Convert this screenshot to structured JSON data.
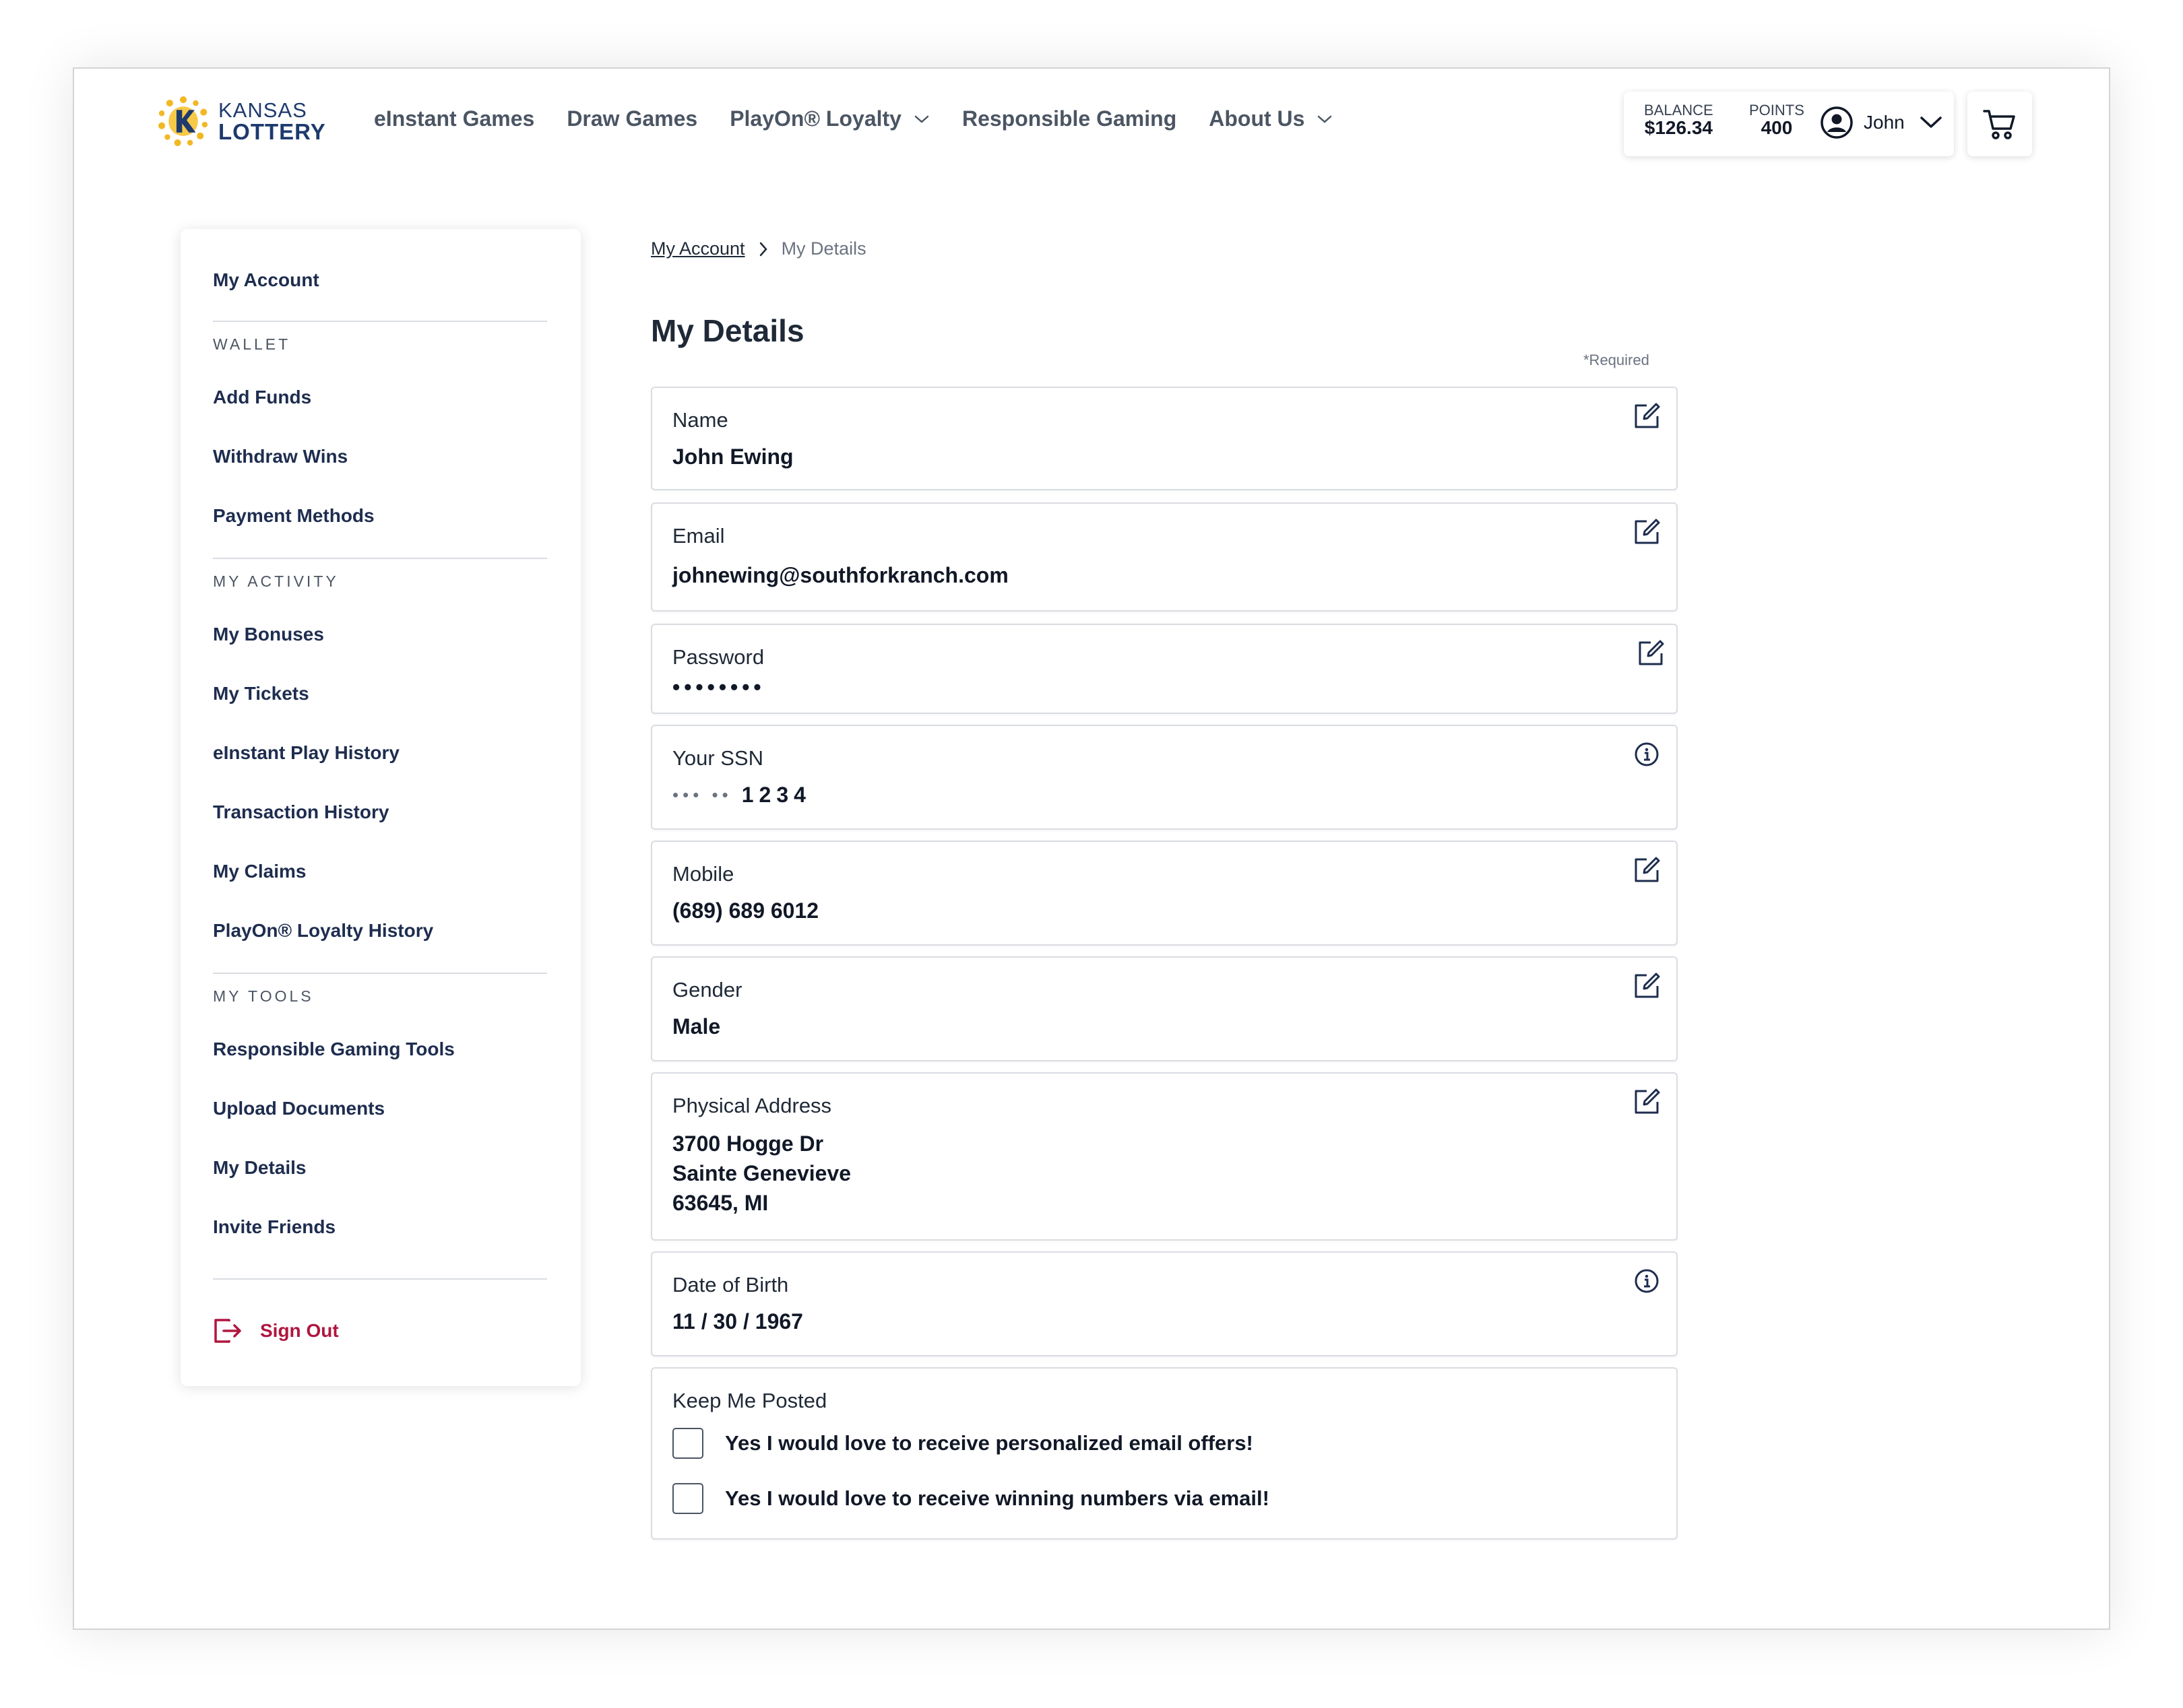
{
  "header": {
    "logo": {
      "line1": "KANSAS",
      "line2": "LOTTERY"
    },
    "nav": [
      {
        "label": "eInstant Games",
        "dropdown": false
      },
      {
        "label": "Draw Games",
        "dropdown": false
      },
      {
        "label": "PlayOn® Loyalty",
        "dropdown": true
      },
      {
        "label": "Responsible Gaming",
        "dropdown": false
      },
      {
        "label": "About Us",
        "dropdown": true
      }
    ],
    "balance": {
      "label": "BALANCE",
      "value": "$126.34"
    },
    "points": {
      "label": "POINTS",
      "value": "400"
    },
    "user": {
      "name": "John"
    }
  },
  "sidebar": {
    "heading": "My Account",
    "wallet": {
      "label": "WALLET",
      "items": [
        "Add Funds",
        "Withdraw Wins",
        "Payment Methods"
      ]
    },
    "activity": {
      "label": "MY ACTIVITY",
      "items": [
        "My Bonuses",
        "My Tickets",
        "eInstant Play History",
        "Transaction History",
        "My Claims",
        "PlayOn® Loyalty History"
      ]
    },
    "tools": {
      "label": "MY TOOLS",
      "items": [
        "Responsible Gaming Tools",
        "Upload Documents",
        "My Details",
        "Invite Friends"
      ]
    },
    "sign_out": "Sign Out"
  },
  "breadcrumb": {
    "root": "My Account",
    "current": "My Details"
  },
  "page": {
    "title": "My Details",
    "required_note": "*Required"
  },
  "fields": {
    "name": {
      "label": "Name",
      "value": "John Ewing"
    },
    "email": {
      "label": "Email",
      "value": "johnewing@southforkranch.com"
    },
    "password": {
      "label": "Password",
      "value": "••••••••"
    },
    "ssn": {
      "label": "Your SSN",
      "masked": "••• ••",
      "digits": "1234"
    },
    "mobile": {
      "label": "Mobile",
      "value": "(689) 689 6012"
    },
    "gender": {
      "label": "Gender",
      "value": "Male"
    },
    "address": {
      "label": "Physical Address",
      "line1": "3700 Hogge Dr",
      "line2": "Sainte Genevieve",
      "line3": "63645, MI"
    },
    "dob": {
      "label": "Date of Birth",
      "value": "11 / 30 / 1967"
    }
  },
  "keep_posted": {
    "label": "Keep Me Posted",
    "options": [
      "Yes I would love to receive personalized email offers!",
      "Yes I would love to receive winning numbers via email!"
    ]
  },
  "colors": {
    "navy": "#1e2d4f",
    "signout_red": "#b0163f",
    "logo_gold": "#f2b824"
  },
  "icons": {
    "edit": "edit-icon",
    "info": "info-icon",
    "cart": "cart-icon",
    "user": "user-circle-icon",
    "sign_out": "sign-out-icon"
  }
}
